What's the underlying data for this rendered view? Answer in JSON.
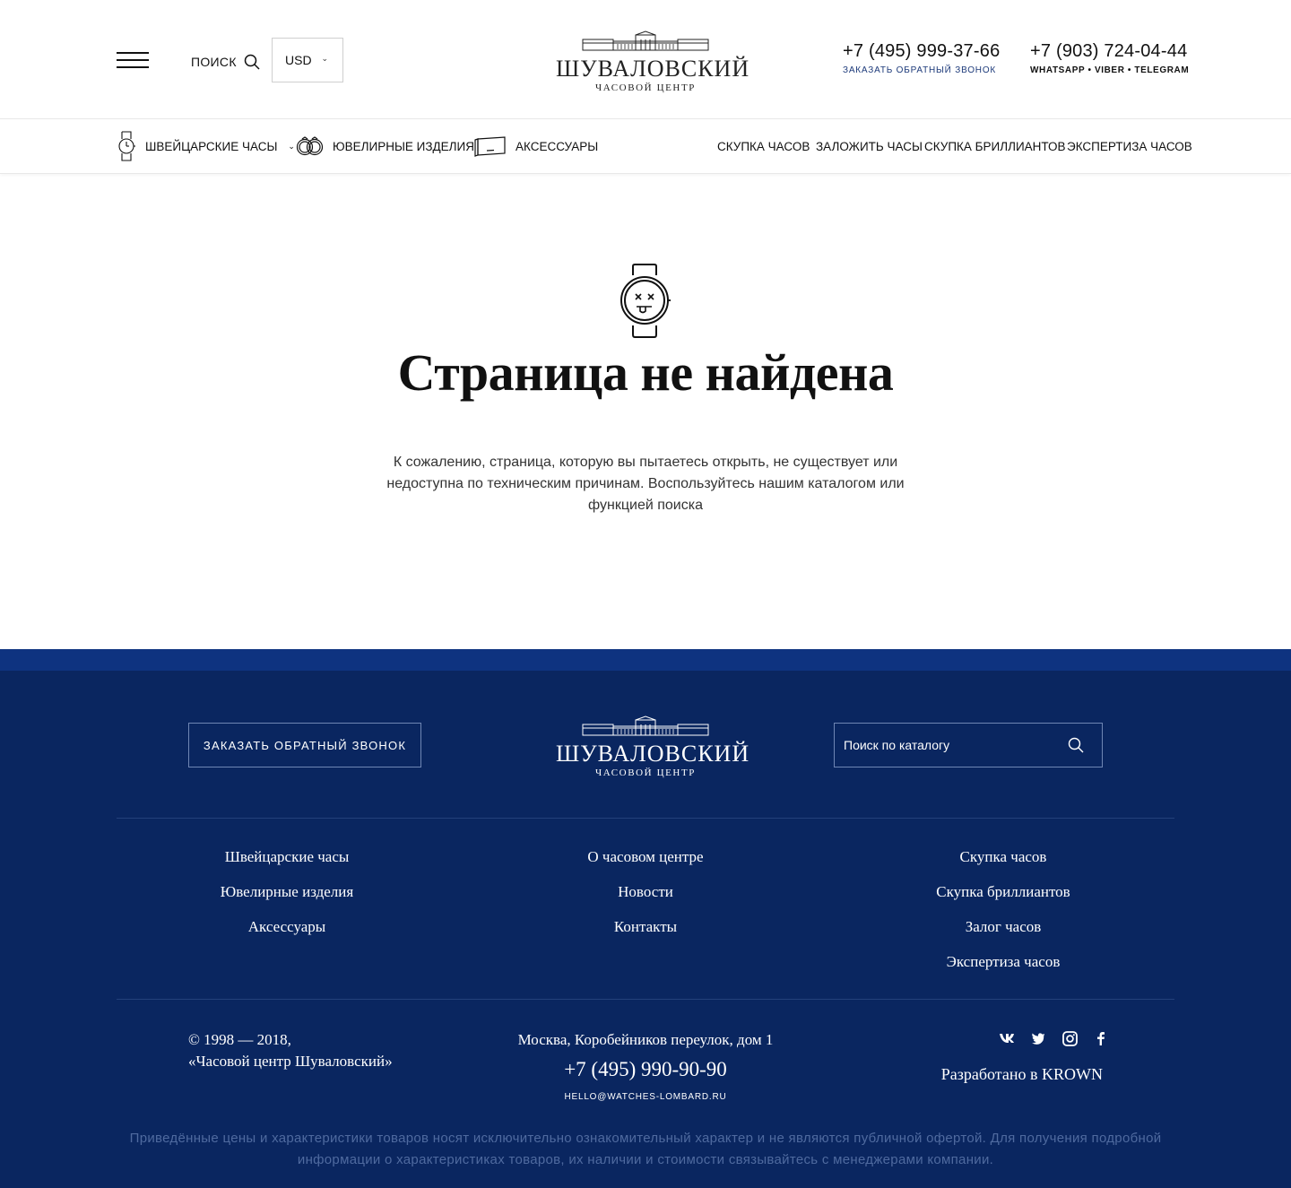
{
  "header": {
    "search_label": "ПОИСК",
    "currency": "USD",
    "logo": {
      "name": "ШУВАЛОВСКИЙ",
      "sub": "ЧАСОВОЙ ЦЕНТР"
    },
    "phone1": {
      "number": "+7 (495) 999-37-66",
      "note": "ЗАКАЗАТЬ ОБРАТНЫЙ ЗВОНОК"
    },
    "phone2": {
      "number": "+7 (903) 724-04-44",
      "note": "WHATSAPP  •  VIBER  •  TELEGRAM"
    }
  },
  "nav": {
    "catalog": [
      {
        "label": "ШВЕЙЦАРСКИЕ ЧАСЫ",
        "icon": "watch-icon",
        "has_dropdown": true
      },
      {
        "label": "ЮВЕЛИРНЫЕ ИЗДЕЛИЯ",
        "icon": "rings-icon"
      },
      {
        "label": "АКСЕССУАРЫ",
        "icon": "box-icon"
      }
    ],
    "services": [
      {
        "label": "СКУПКА ЧАСОВ"
      },
      {
        "label": "ЗАЛОЖИТЬ ЧАСЫ"
      },
      {
        "label": "СКУПКА БРИЛЛИАНТОВ"
      },
      {
        "label": "ЭКСПЕРТИЗА ЧАСОВ"
      }
    ]
  },
  "main": {
    "icon": "broken-watch-icon",
    "title": "Страница не найдена",
    "text": "К сожалению, страница, которую вы пытаетесь открыть, не существует или недоступна по техническим причинам. Воспользуйтесь нашим каталогом или функцией поиска"
  },
  "footer": {
    "callback_label": "ЗАКАЗАТЬ ОБРАТНЫЙ ЗВОНОК",
    "logo": {
      "name": "ШУВАЛОВСКИЙ",
      "sub": "ЧАСОВОЙ ЦЕНТР"
    },
    "search_placeholder": "Поиск по каталогу",
    "links": {
      "col1": [
        "Швейцарские часы",
        "Ювелирные изделия",
        "Аксессуары"
      ],
      "col2": [
        "О часовом центре",
        "Новости",
        "Контакты"
      ],
      "col3": [
        "Скупка часов",
        "Скупка бриллиантов",
        "Залог часов",
        "Экспертиза часов"
      ]
    },
    "copyright_line1": "© 1998 — 2018,",
    "copyright_line2": "«Часовой центр Шуваловский»",
    "address": "Москва, Коробейников переулок, дом 1",
    "phone": "+7 (495) 990-90-90",
    "email": "HELLO@WATCHES-LOMBARD.RU",
    "social": [
      "vk-icon",
      "twitter-icon",
      "instagram-icon",
      "facebook-icon"
    ],
    "developer": "Разработано в KROWN",
    "disclaimer": "Приведённые цены и характеристики товаров носят исключительно ознакомительный характер и не являются публичной офертой. Для получения подробной информации о характеристиках товаров, их наличии и стоимости связывайтесь с менеджерами компании."
  },
  "colors": {
    "footer_bg": "#0a2660",
    "footer_stripe": "#0e3380",
    "accent_link": "#1d3a7a",
    "disclaimer": "#4f6a9f"
  }
}
